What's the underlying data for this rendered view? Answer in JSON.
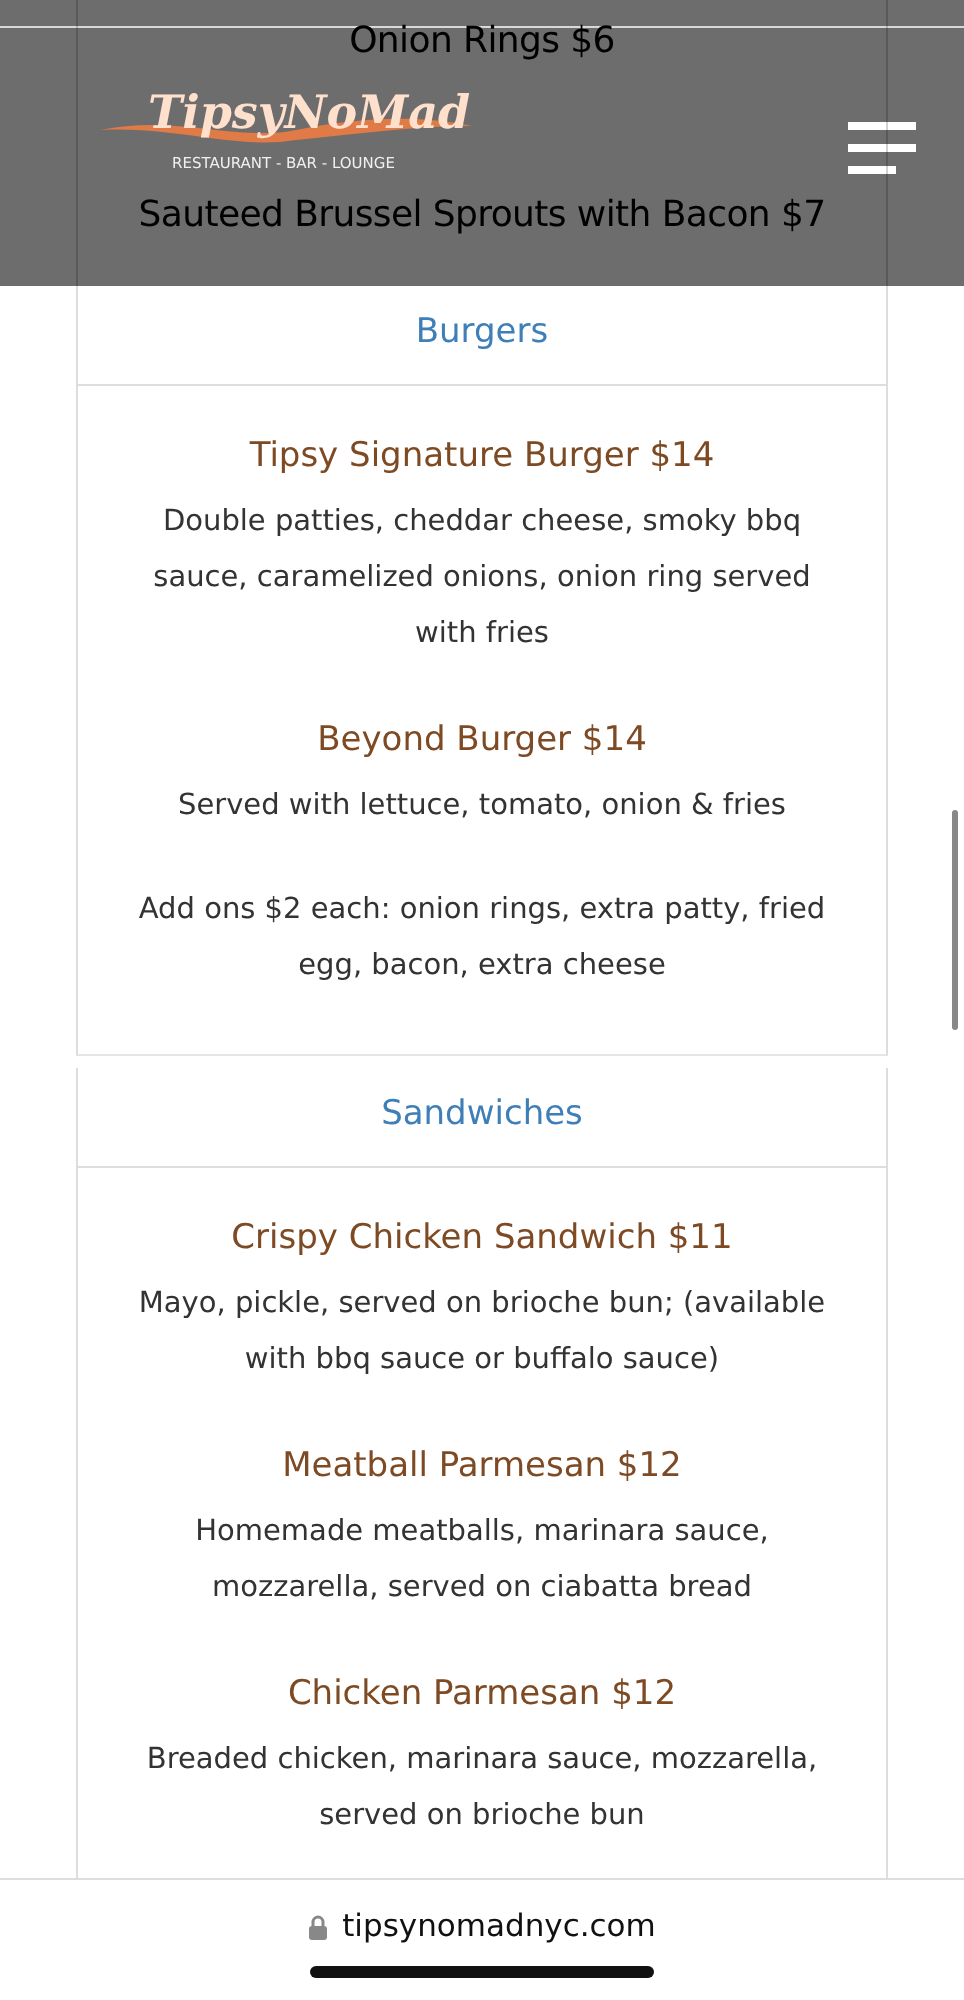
{
  "header": {
    "logo": "TipsyNoMad",
    "tagline": "RESTAURANT - BAR - LOUNGE"
  },
  "top_items": [
    {
      "name": "Onion Rings $6"
    },
    {
      "name": "Sauteed Brussel Sprouts with Bacon $7"
    }
  ],
  "sections": [
    {
      "title": "Burgers",
      "items": [
        {
          "name": "Tipsy Signature Burger $14",
          "description": [
            "Double patties, cheddar cheese, smoky bbq sauce, caramelized onions, onion ring served with fries"
          ]
        },
        {
          "name": "Beyond Burger $14",
          "description": [
            "Served with lettuce, tomato, onion & fries",
            "Add ons $2 each: onion rings, extra patty, fried egg, bacon, extra cheese"
          ]
        }
      ]
    },
    {
      "title": "Sandwiches",
      "items": [
        {
          "name": "Crispy Chicken Sandwich $11",
          "description": [
            "Mayo, pickle, served on brioche bun; (available with bbq sauce or buffalo sauce)"
          ]
        },
        {
          "name": "Meatball Parmesan $12",
          "description": [
            "Homemade meatballs, marinara sauce, mozzarella, served on ciabatta bread"
          ]
        },
        {
          "name": "Chicken Parmesan $12",
          "description": [
            "Breaded chicken, marinara sauce, mozzarella, served on brioche bun"
          ]
        }
      ]
    }
  ],
  "browser": {
    "url": "tipsynomadnyc.com"
  }
}
